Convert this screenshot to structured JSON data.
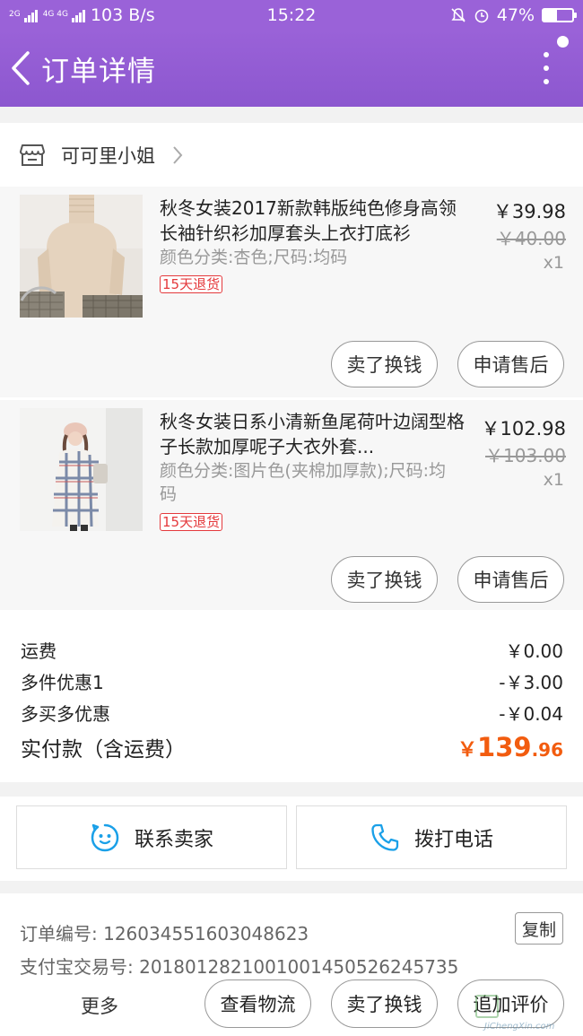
{
  "status_bar": {
    "network": "2G",
    "network2": "4G 4G",
    "speed": "103 B/s",
    "time": "15:22",
    "battery": "47%",
    "battery_level": 0.47
  },
  "nav": {
    "title": "订单详情"
  },
  "shop": {
    "name": "可可里小姐"
  },
  "items": [
    {
      "title": "秋冬女装2017新款韩版纯色修身高领长袖针织衫加厚套头上衣打底衫",
      "spec": "颜色分类:杏色;尺码:均码",
      "badge": "15天退货",
      "price": "￥39.98",
      "old_price": "￥40.00",
      "qty": "x1",
      "btn_sell": "卖了换钱",
      "btn_after": "申请售后"
    },
    {
      "title": "秋冬女装日系小清新鱼尾荷叶边阔型格子长款加厚呢子大衣外套...",
      "spec": "颜色分类:图片色(夹棉加厚款);尺码:均码",
      "badge": "15天退货",
      "price": "￥102.98",
      "old_price": "￥103.00",
      "qty": "x1",
      "btn_sell": "卖了换钱",
      "btn_after": "申请售后"
    }
  ],
  "summary": {
    "shipping_label": "运费",
    "shipping_value": "￥0.00",
    "discount1_label": "多件优惠1",
    "discount1_value": "-￥3.00",
    "discount2_label": "多买多优惠",
    "discount2_value": "-￥0.04",
    "total_label": "实付款（含运费）",
    "total_currency": "￥",
    "total_int": "139",
    "total_dec": ".96"
  },
  "contact": {
    "seller": "联系卖家",
    "phone": "拨打电话"
  },
  "order_info": {
    "order_no": "订单编号: 126034551603048623",
    "alipay_no": "支付宝交易号: 2018012821001001450526245735",
    "copy": "复制"
  },
  "bottom_bar": {
    "more": "更多",
    "logistics": "查看物流",
    "sell": "卖了换钱",
    "review": "追加评价"
  },
  "watermark": {
    "url": "JiChengXin.com"
  },
  "colors": {
    "header": "#9a62d8",
    "accent_price": "#f25c0f",
    "badge_red": "#e4393c",
    "icon_blue": "#1aa0e8"
  }
}
